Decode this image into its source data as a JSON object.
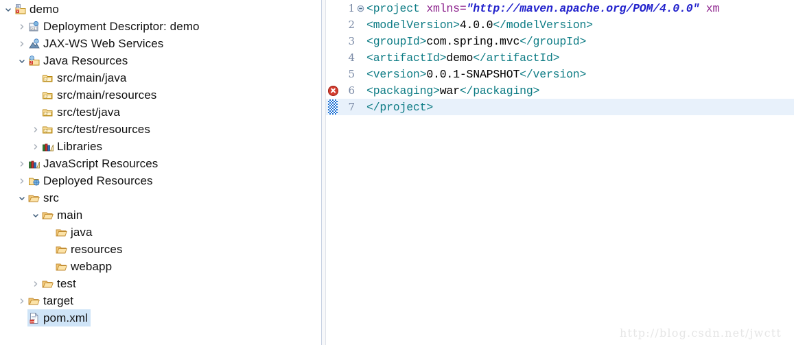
{
  "explorer": {
    "name": "project-explorer",
    "items": [
      {
        "label": "demo",
        "icon": "maven-project-icon",
        "indent": 0,
        "twisty": "down",
        "selected": false
      },
      {
        "label": "Deployment Descriptor: demo",
        "icon": "deployment-descriptor-icon",
        "indent": 1,
        "twisty": "right",
        "selected": false
      },
      {
        "label": "JAX-WS Web Services",
        "icon": "jaxws-web-services-icon",
        "indent": 1,
        "twisty": "right",
        "selected": false
      },
      {
        "label": "Java Resources",
        "icon": "java-resources-icon",
        "indent": 1,
        "twisty": "down",
        "selected": false
      },
      {
        "label": "src/main/java",
        "icon": "source-folder-icon",
        "indent": 2,
        "twisty": "none",
        "selected": false
      },
      {
        "label": "src/main/resources",
        "icon": "source-folder-icon",
        "indent": 2,
        "twisty": "none",
        "selected": false
      },
      {
        "label": "src/test/java",
        "icon": "source-folder-icon",
        "indent": 2,
        "twisty": "none",
        "selected": false
      },
      {
        "label": "src/test/resources",
        "icon": "source-folder-icon",
        "indent": 2,
        "twisty": "right",
        "selected": false
      },
      {
        "label": "Libraries",
        "icon": "libraries-icon",
        "indent": 2,
        "twisty": "right",
        "selected": false
      },
      {
        "label": "JavaScript Resources",
        "icon": "libraries-icon",
        "indent": 1,
        "twisty": "right",
        "selected": false
      },
      {
        "label": "Deployed Resources",
        "icon": "deployed-resources-icon",
        "indent": 1,
        "twisty": "right",
        "selected": false
      },
      {
        "label": "src",
        "icon": "folder-icon",
        "indent": 1,
        "twisty": "down",
        "selected": false
      },
      {
        "label": "main",
        "icon": "folder-icon",
        "indent": 2,
        "twisty": "down",
        "selected": false
      },
      {
        "label": "java",
        "icon": "folder-icon",
        "indent": 3,
        "twisty": "none",
        "selected": false
      },
      {
        "label": "resources",
        "icon": "folder-icon",
        "indent": 3,
        "twisty": "none",
        "selected": false
      },
      {
        "label": "webapp",
        "icon": "folder-icon",
        "indent": 3,
        "twisty": "none",
        "selected": false
      },
      {
        "label": "test",
        "icon": "folder-icon",
        "indent": 2,
        "twisty": "right",
        "selected": false
      },
      {
        "label": "target",
        "icon": "folder-icon",
        "indent": 1,
        "twisty": "right",
        "selected": false
      },
      {
        "label": "pom.xml",
        "icon": "xml-file-icon",
        "indent": 1,
        "twisty": "none",
        "selected": true
      }
    ]
  },
  "editor": {
    "name": "pom-xml-editor",
    "lines": [
      {
        "number": "1",
        "fold": "collapse",
        "marker": "none",
        "current": false,
        "segments": [
          {
            "text": "<project ",
            "cls": "tag"
          },
          {
            "text": "xmlns=",
            "cls": "attr"
          },
          {
            "text": "\"http://maven.apache.org/POM/4.0.0\"",
            "cls": "val"
          },
          {
            "text": " xm",
            "cls": "attr"
          }
        ]
      },
      {
        "number": "2",
        "fold": "none",
        "marker": "none",
        "current": false,
        "segments": [
          {
            "text": "  <modelVersion>",
            "cls": "tag"
          },
          {
            "text": "4.0.0",
            "cls": "txt"
          },
          {
            "text": "</modelVersion>",
            "cls": "tag"
          }
        ]
      },
      {
        "number": "3",
        "fold": "none",
        "marker": "none",
        "current": false,
        "segments": [
          {
            "text": "  <groupId>",
            "cls": "tag"
          },
          {
            "text": "com.spring.mvc",
            "cls": "txt"
          },
          {
            "text": "</groupId>",
            "cls": "tag"
          }
        ]
      },
      {
        "number": "4",
        "fold": "none",
        "marker": "none",
        "current": false,
        "segments": [
          {
            "text": "  <artifactId>",
            "cls": "tag"
          },
          {
            "text": "demo",
            "cls": "txt"
          },
          {
            "text": "</artifactId>",
            "cls": "tag"
          }
        ]
      },
      {
        "number": "5",
        "fold": "none",
        "marker": "none",
        "current": false,
        "segments": [
          {
            "text": "  <version>",
            "cls": "tag"
          },
          {
            "text": "0.0.1-SNAPSHOT",
            "cls": "txt"
          },
          {
            "text": "</version>",
            "cls": "tag"
          }
        ]
      },
      {
        "number": "6",
        "fold": "none",
        "marker": "error",
        "current": false,
        "segments": [
          {
            "text": "  <packaging>",
            "cls": "tag"
          },
          {
            "text": "war",
            "cls": "txt"
          },
          {
            "text": "</packaging>",
            "cls": "tag"
          }
        ]
      },
      {
        "number": "7",
        "fold": "none",
        "marker": "checker",
        "current": true,
        "segments": [
          {
            "text": "</project>",
            "cls": "tag"
          }
        ]
      }
    ]
  },
  "watermark": {
    "text": "http://blog.csdn.net/jwctt"
  },
  "colors": {
    "selection": "#cfe4f7",
    "current_line": "#e8f1fb",
    "tag": "#0c7b84",
    "attribute": "#8b1f8b",
    "value": "#2222cc",
    "line_number": "#7a8aa6",
    "error": "#d43d2f"
  }
}
